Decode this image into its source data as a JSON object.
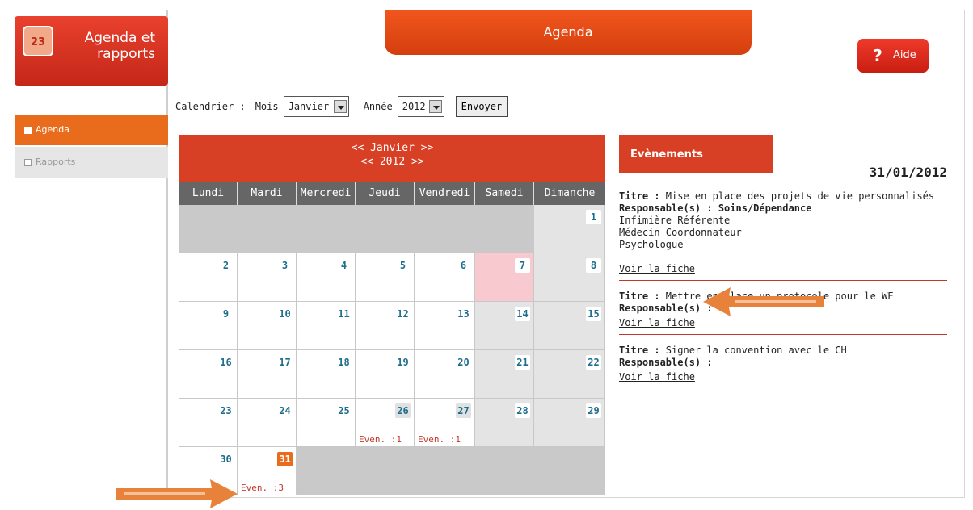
{
  "app": {
    "title_line1": "Agenda et",
    "title_line2": "rapports",
    "logo_day": "23"
  },
  "sidebar": {
    "items": [
      {
        "label": "Agenda",
        "active": true
      },
      {
        "label": "Rapports",
        "active": false
      }
    ]
  },
  "header": {
    "title": "Agenda",
    "help": {
      "icon": "?",
      "label": "Aide"
    }
  },
  "filters": {
    "label": "Calendrier :",
    "mois_label": "Mois",
    "mois_value": "Janvier",
    "annee_label": "Année",
    "annee_value": "2012",
    "submit": "Envoyer"
  },
  "calendar": {
    "nav_month": "<< Janvier >>",
    "nav_year": "<< 2012 >>",
    "weekdays": [
      "Lundi",
      "Mardi",
      "Mercredi",
      "Jeudi",
      "Vendredi",
      "Samedi",
      "Dimanche"
    ],
    "weeks": [
      [
        null,
        null,
        null,
        null,
        null,
        null,
        {
          "d": "1"
        }
      ],
      [
        {
          "d": "2"
        },
        {
          "d": "3"
        },
        {
          "d": "4"
        },
        {
          "d": "5"
        },
        {
          "d": "6"
        },
        {
          "d": "7",
          "pink": true
        },
        {
          "d": "8"
        }
      ],
      [
        {
          "d": "9"
        },
        {
          "d": "10"
        },
        {
          "d": "11"
        },
        {
          "d": "12"
        },
        {
          "d": "13"
        },
        {
          "d": "14"
        },
        {
          "d": "15"
        }
      ],
      [
        {
          "d": "16"
        },
        {
          "d": "17"
        },
        {
          "d": "18"
        },
        {
          "d": "19"
        },
        {
          "d": "20"
        },
        {
          "d": "21"
        },
        {
          "d": "22"
        }
      ],
      [
        {
          "d": "23"
        },
        {
          "d": "24"
        },
        {
          "d": "25"
        },
        {
          "d": "26",
          "ev": "Even. :1",
          "gray": true
        },
        {
          "d": "27",
          "ev": "Even. :1",
          "gray": true
        },
        {
          "d": "28"
        },
        {
          "d": "29"
        }
      ],
      [
        {
          "d": "30"
        },
        {
          "d": "31",
          "ev": "Even. :3",
          "hl": true
        },
        null,
        null,
        null,
        null,
        null
      ]
    ]
  },
  "events_panel": {
    "title": "Evènements",
    "date": "31/01/2012",
    "items": [
      {
        "titre_label": "Titre :",
        "titre": "Mise en place des projets de vie personnalisés",
        "resp_label": "Responsable(s) :",
        "resp": "Soins/Dépendance",
        "roles": [
          "Infimière Référente",
          "Médecin Coordonnateur",
          "Psychologue"
        ],
        "link": "Voir la fiche"
      },
      {
        "titre_label": "Titre :",
        "titre": "Mettre en place un protocole pour le WE",
        "resp_label": "Responsable(s) :",
        "resp": "",
        "roles": [],
        "link": "Voir la fiche"
      },
      {
        "titre_label": "Titre :",
        "titre": "Signer la convention avec le CH",
        "resp_label": "Responsable(s) :",
        "resp": "",
        "roles": [],
        "link": "Voir la fiche"
      }
    ]
  },
  "colors": {
    "accent": "#e86c1c",
    "red": "#d84025",
    "link": "#1c6e8c"
  }
}
